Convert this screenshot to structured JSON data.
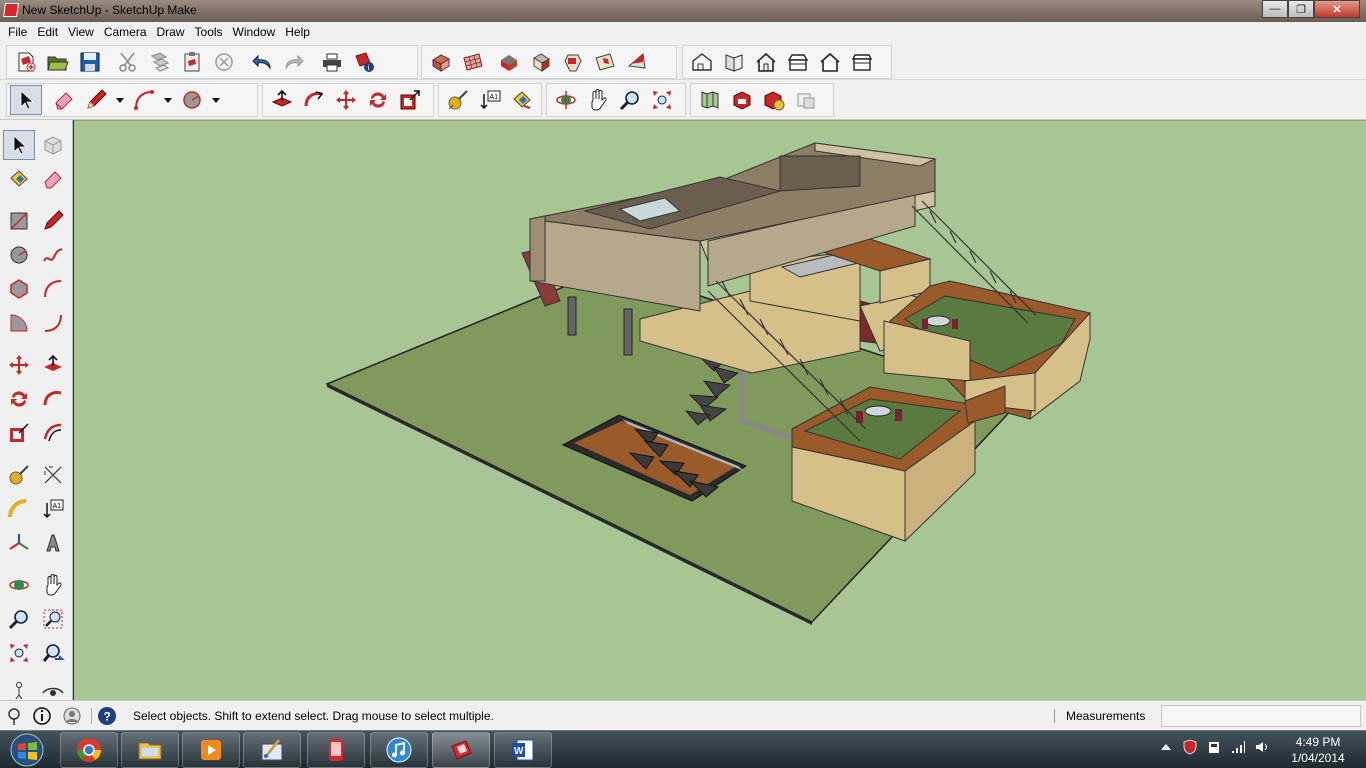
{
  "window": {
    "title": "New SketchUp - SketchUp Make"
  },
  "menu": [
    "File",
    "Edit",
    "View",
    "Camera",
    "Draw",
    "Tools",
    "Window",
    "Help"
  ],
  "status": {
    "message": "Select objects. Shift to extend select. Drag mouse to select multiple.",
    "measurements_label": "Measurements",
    "measurements_value": ""
  },
  "taskbar": {
    "apps": [
      "start-orb",
      "chrome",
      "file-explorer",
      "media-player",
      "paint",
      "phone-app",
      "itunes",
      "sketchup",
      "word"
    ],
    "active": "sketchup"
  },
  "clock": {
    "time": "4:49 PM",
    "date": "1/04/2014"
  },
  "colors": {
    "sky_ground": "#a7c694",
    "grass": "#7f9a5c",
    "brick": "#d6c08a",
    "wood": "#9a5a2a",
    "concrete": "#b0a88a",
    "titlebar": "#6c5d54"
  }
}
